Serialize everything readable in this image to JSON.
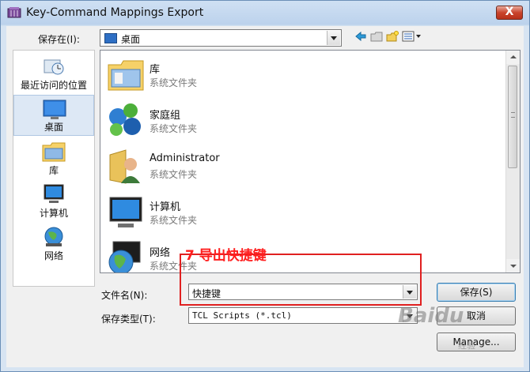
{
  "window": {
    "title": "Key-Command Mappings Export",
    "close_glyph": "X"
  },
  "location": {
    "label": "保存在(I):",
    "value": "桌面"
  },
  "places": [
    {
      "label": "最近访问的位置",
      "icon": "recent-places-icon"
    },
    {
      "label": "桌面",
      "icon": "desktop-icon",
      "selected": true
    },
    {
      "label": "库",
      "icon": "library-icon"
    },
    {
      "label": "计算机",
      "icon": "computer-icon"
    },
    {
      "label": "网络",
      "icon": "network-icon"
    }
  ],
  "files": [
    {
      "name": "库",
      "type": "系统文件夹",
      "icon": "library-icon"
    },
    {
      "name": "家庭组",
      "type": "系统文件夹",
      "icon": "homegroup-icon"
    },
    {
      "name": "Administrator",
      "type": "系统文件夹",
      "icon": "user-folder-icon"
    },
    {
      "name": "计算机",
      "type": "系统文件夹",
      "icon": "computer-icon"
    },
    {
      "name": "网络",
      "type": "系统文件夹",
      "icon": "network-icon"
    }
  ],
  "filename": {
    "label": "文件名(N):",
    "value": "快捷键"
  },
  "filetype": {
    "label": "保存类型(T):",
    "value": "TCL Scripts (*.tcl)"
  },
  "buttons": {
    "save": "保存(S)",
    "cancel": "取消",
    "manage": "Manage..."
  },
  "annotation": {
    "text": "7 导出快捷键",
    "color": "#ff1e1e"
  },
  "watermark": {
    "brand": "Baidu",
    "sub": "经验"
  },
  "colors": {
    "accent": "#3c7fb1",
    "close": "#c9442c"
  }
}
